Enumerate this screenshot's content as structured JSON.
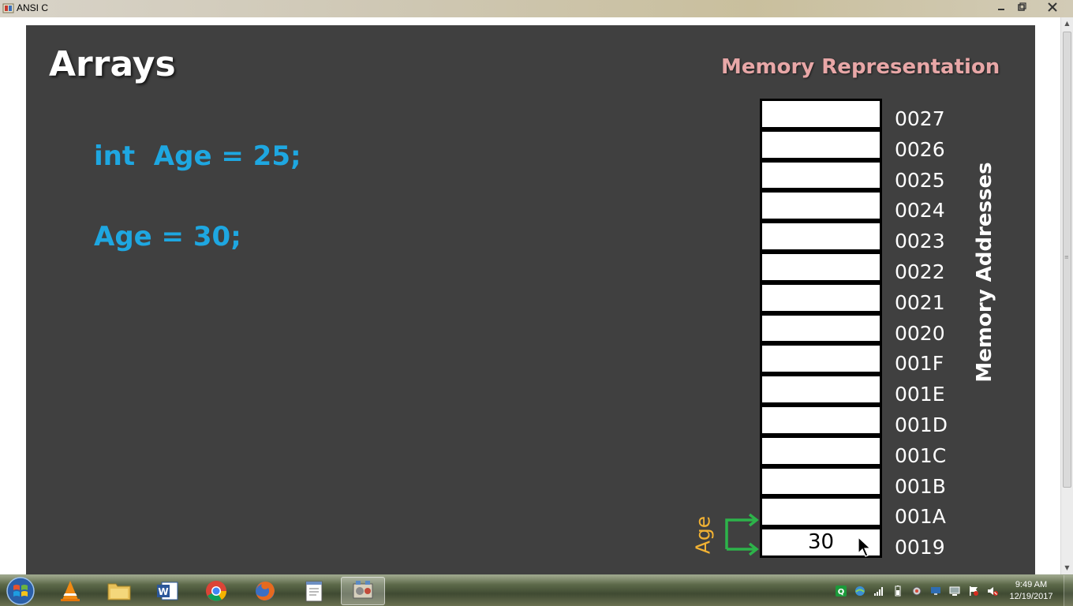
{
  "window": {
    "title": "ANSI C",
    "minimize_icon": "minimize-icon",
    "maximize_icon": "restore-icon",
    "close_icon": "close-icon"
  },
  "slide": {
    "title": "Arrays",
    "code_lines": [
      "int  Age = 25;",
      "Age = 30;"
    ],
    "memory_heading": "Memory Representation",
    "memory_axis_label": "Memory Addresses",
    "variable_label": "Age",
    "memory_rows": [
      {
        "address": "0027",
        "value": ""
      },
      {
        "address": "0026",
        "value": ""
      },
      {
        "address": "0025",
        "value": ""
      },
      {
        "address": "0024",
        "value": ""
      },
      {
        "address": "0023",
        "value": ""
      },
      {
        "address": "0022",
        "value": ""
      },
      {
        "address": "0021",
        "value": ""
      },
      {
        "address": "0020",
        "value": ""
      },
      {
        "address": "001F",
        "value": ""
      },
      {
        "address": "001E",
        "value": ""
      },
      {
        "address": "001D",
        "value": ""
      },
      {
        "address": "001C",
        "value": ""
      },
      {
        "address": "001B",
        "value": ""
      },
      {
        "address": "001A",
        "value": ""
      },
      {
        "address": "0019",
        "value": "30"
      }
    ],
    "colors": {
      "background": "#404040",
      "title": "#ffffff",
      "code": "#1ea7e1",
      "memory_heading": "#e8a7a7",
      "variable_label": "#f2b233",
      "arrow": "#2db34a"
    }
  },
  "taskbar": {
    "start_icon": "windows-start-icon",
    "apps": [
      {
        "name": "vlc-icon"
      },
      {
        "name": "file-explorer-icon"
      },
      {
        "name": "word-icon"
      },
      {
        "name": "chrome-icon"
      },
      {
        "name": "firefox-icon"
      },
      {
        "name": "notepad-icon"
      },
      {
        "name": "media-tool-icon",
        "active": true
      }
    ],
    "tray_icons": [
      "q-app-icon",
      "network-globe-icon",
      "signal-bars-icon",
      "battery-icon",
      "gear-icon",
      "display-icon",
      "monitor-icon",
      "flag-icon",
      "speaker-muted-icon"
    ],
    "clock_time": "9:49 AM",
    "clock_date": "12/19/2017"
  }
}
